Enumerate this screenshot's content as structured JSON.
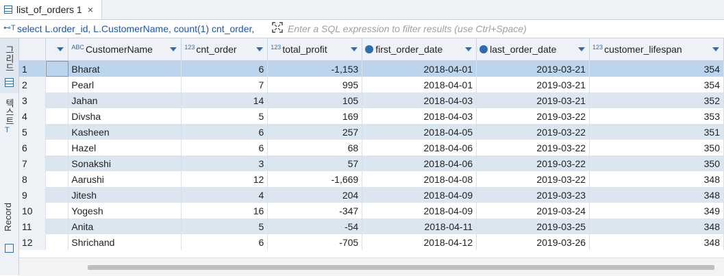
{
  "tab": {
    "label": "list_of_orders 1",
    "close": "×"
  },
  "filter": {
    "sql_icon": "⊷T",
    "sql": "select L.order_id, L.CustomerName, count(1) cnt_order,",
    "placeholder": "Enter a SQL expression to filter results (use Ctrl+Space)"
  },
  "left_panel": {
    "grid_label": "그리드",
    "text_label": "텍스트",
    "record_label": "Record"
  },
  "columns": [
    {
      "type": "ABC",
      "name": "CustomerName"
    },
    {
      "type": "123",
      "name": "cnt_order"
    },
    {
      "type": "123",
      "name": "total_profit"
    },
    {
      "type": "clock",
      "name": "first_order_date"
    },
    {
      "type": "clock",
      "name": "last_order_date"
    },
    {
      "type": "123",
      "name": "customer_lifespan"
    }
  ],
  "rows": [
    {
      "n": "1",
      "name": "Bharat",
      "cnt": "6",
      "profit": "-1,153",
      "first": "2018-04-01",
      "last": "2019-03-21",
      "life": "354"
    },
    {
      "n": "2",
      "name": "Pearl",
      "cnt": "7",
      "profit": "995",
      "first": "2018-04-01",
      "last": "2019-03-21",
      "life": "354"
    },
    {
      "n": "3",
      "name": "Jahan",
      "cnt": "14",
      "profit": "105",
      "first": "2018-04-03",
      "last": "2019-03-21",
      "life": "352"
    },
    {
      "n": "4",
      "name": "Divsha",
      "cnt": "5",
      "profit": "169",
      "first": "2018-04-03",
      "last": "2019-03-22",
      "life": "353"
    },
    {
      "n": "5",
      "name": "Kasheen",
      "cnt": "6",
      "profit": "257",
      "first": "2018-04-05",
      "last": "2019-03-22",
      "life": "351"
    },
    {
      "n": "6",
      "name": "Hazel",
      "cnt": "6",
      "profit": "68",
      "first": "2018-04-06",
      "last": "2019-03-22",
      "life": "350"
    },
    {
      "n": "7",
      "name": "Sonakshi",
      "cnt": "3",
      "profit": "57",
      "first": "2018-04-06",
      "last": "2019-03-22",
      "life": "350"
    },
    {
      "n": "8",
      "name": "Aarushi",
      "cnt": "12",
      "profit": "-1,669",
      "first": "2018-04-08",
      "last": "2019-03-22",
      "life": "348"
    },
    {
      "n": "9",
      "name": "Jitesh",
      "cnt": "4",
      "profit": "204",
      "first": "2018-04-09",
      "last": "2019-03-23",
      "life": "348"
    },
    {
      "n": "10",
      "name": "Yogesh",
      "cnt": "16",
      "profit": "-347",
      "first": "2018-04-09",
      "last": "2019-03-24",
      "life": "349"
    },
    {
      "n": "11",
      "name": "Anita",
      "cnt": "5",
      "profit": "-54",
      "first": "2018-04-11",
      "last": "2019-03-25",
      "life": "348"
    },
    {
      "n": "12",
      "name": "Shrichand",
      "cnt": "6",
      "profit": "-705",
      "first": "2018-04-12",
      "last": "2019-03-26",
      "life": "348"
    }
  ]
}
